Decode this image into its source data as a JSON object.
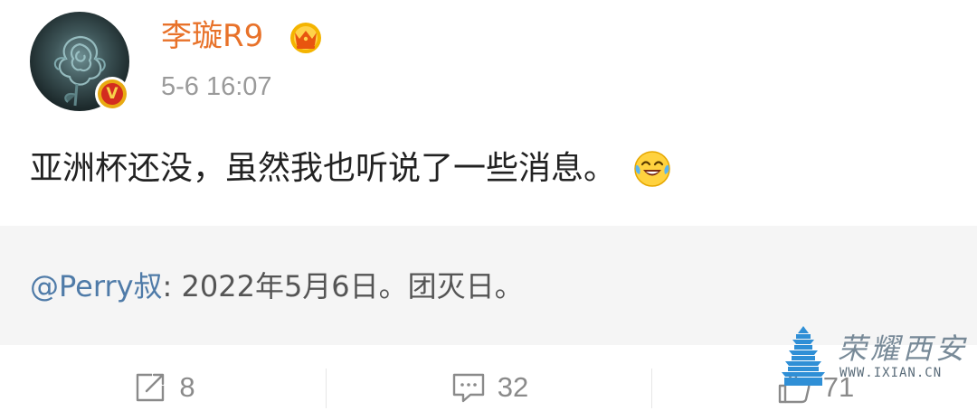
{
  "header": {
    "username": "李璇R9",
    "timestamp": "5-6 16:07",
    "verified_badge": "V",
    "username_color": "#e8722a",
    "membership_icon": "crown-icon",
    "avatar_icon": "rose-avatar"
  },
  "post": {
    "text": "亚洲杯还没，虽然我也听说了一些消息。",
    "emoji": "laughing-crying-emoji"
  },
  "repost": {
    "author": "@Perry叔",
    "separator": ": ",
    "content": "2022年5月6日。团灭日。",
    "author_color": "#4f7ba8",
    "background": "#f5f5f5"
  },
  "actions": [
    {
      "icon": "share-icon",
      "count": "8"
    },
    {
      "icon": "comment-icon",
      "count": "32"
    },
    {
      "icon": "like-icon",
      "count": "71"
    }
  ],
  "watermark": {
    "title": "荣耀西安",
    "url": "WWW.IXIAN.CN"
  }
}
